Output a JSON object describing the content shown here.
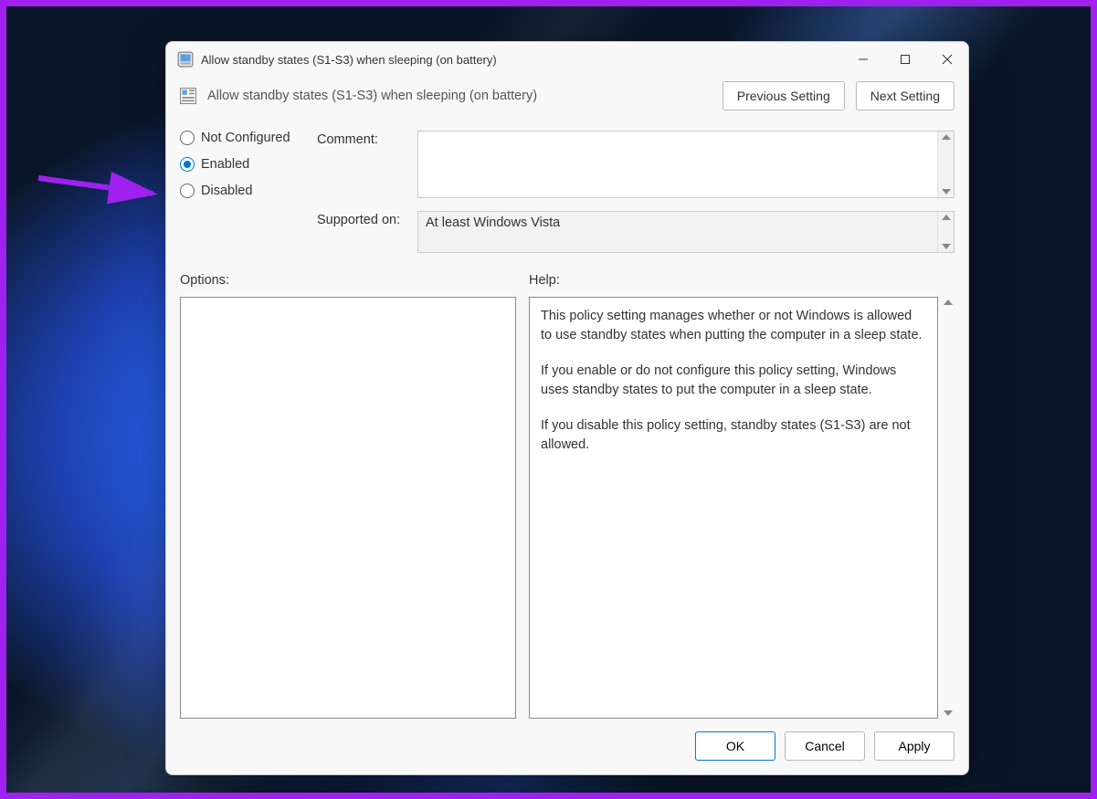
{
  "window": {
    "title": "Allow standby states (S1-S3) when sleeping (on battery)"
  },
  "header": {
    "policy_name": "Allow standby states (S1-S3) when sleeping (on battery)",
    "prev_btn": "Previous Setting",
    "next_btn": "Next Setting"
  },
  "radios": {
    "not_configured": "Not Configured",
    "enabled": "Enabled",
    "disabled": "Disabled",
    "selected": "enabled"
  },
  "fields": {
    "comment_label": "Comment:",
    "comment_value": "",
    "supported_label": "Supported on:",
    "supported_value": "At least Windows Vista"
  },
  "sections": {
    "options_label": "Options:",
    "help_label": "Help:"
  },
  "help": {
    "p1": "This policy setting manages whether or not Windows is allowed to use standby states when putting the computer in a sleep state.",
    "p2": "If you enable or do not configure this policy setting, Windows uses standby states to put the computer in a sleep state.",
    "p3": "If you disable this policy setting, standby states (S1-S3) are not allowed."
  },
  "footer": {
    "ok": "OK",
    "cancel": "Cancel",
    "apply": "Apply"
  }
}
